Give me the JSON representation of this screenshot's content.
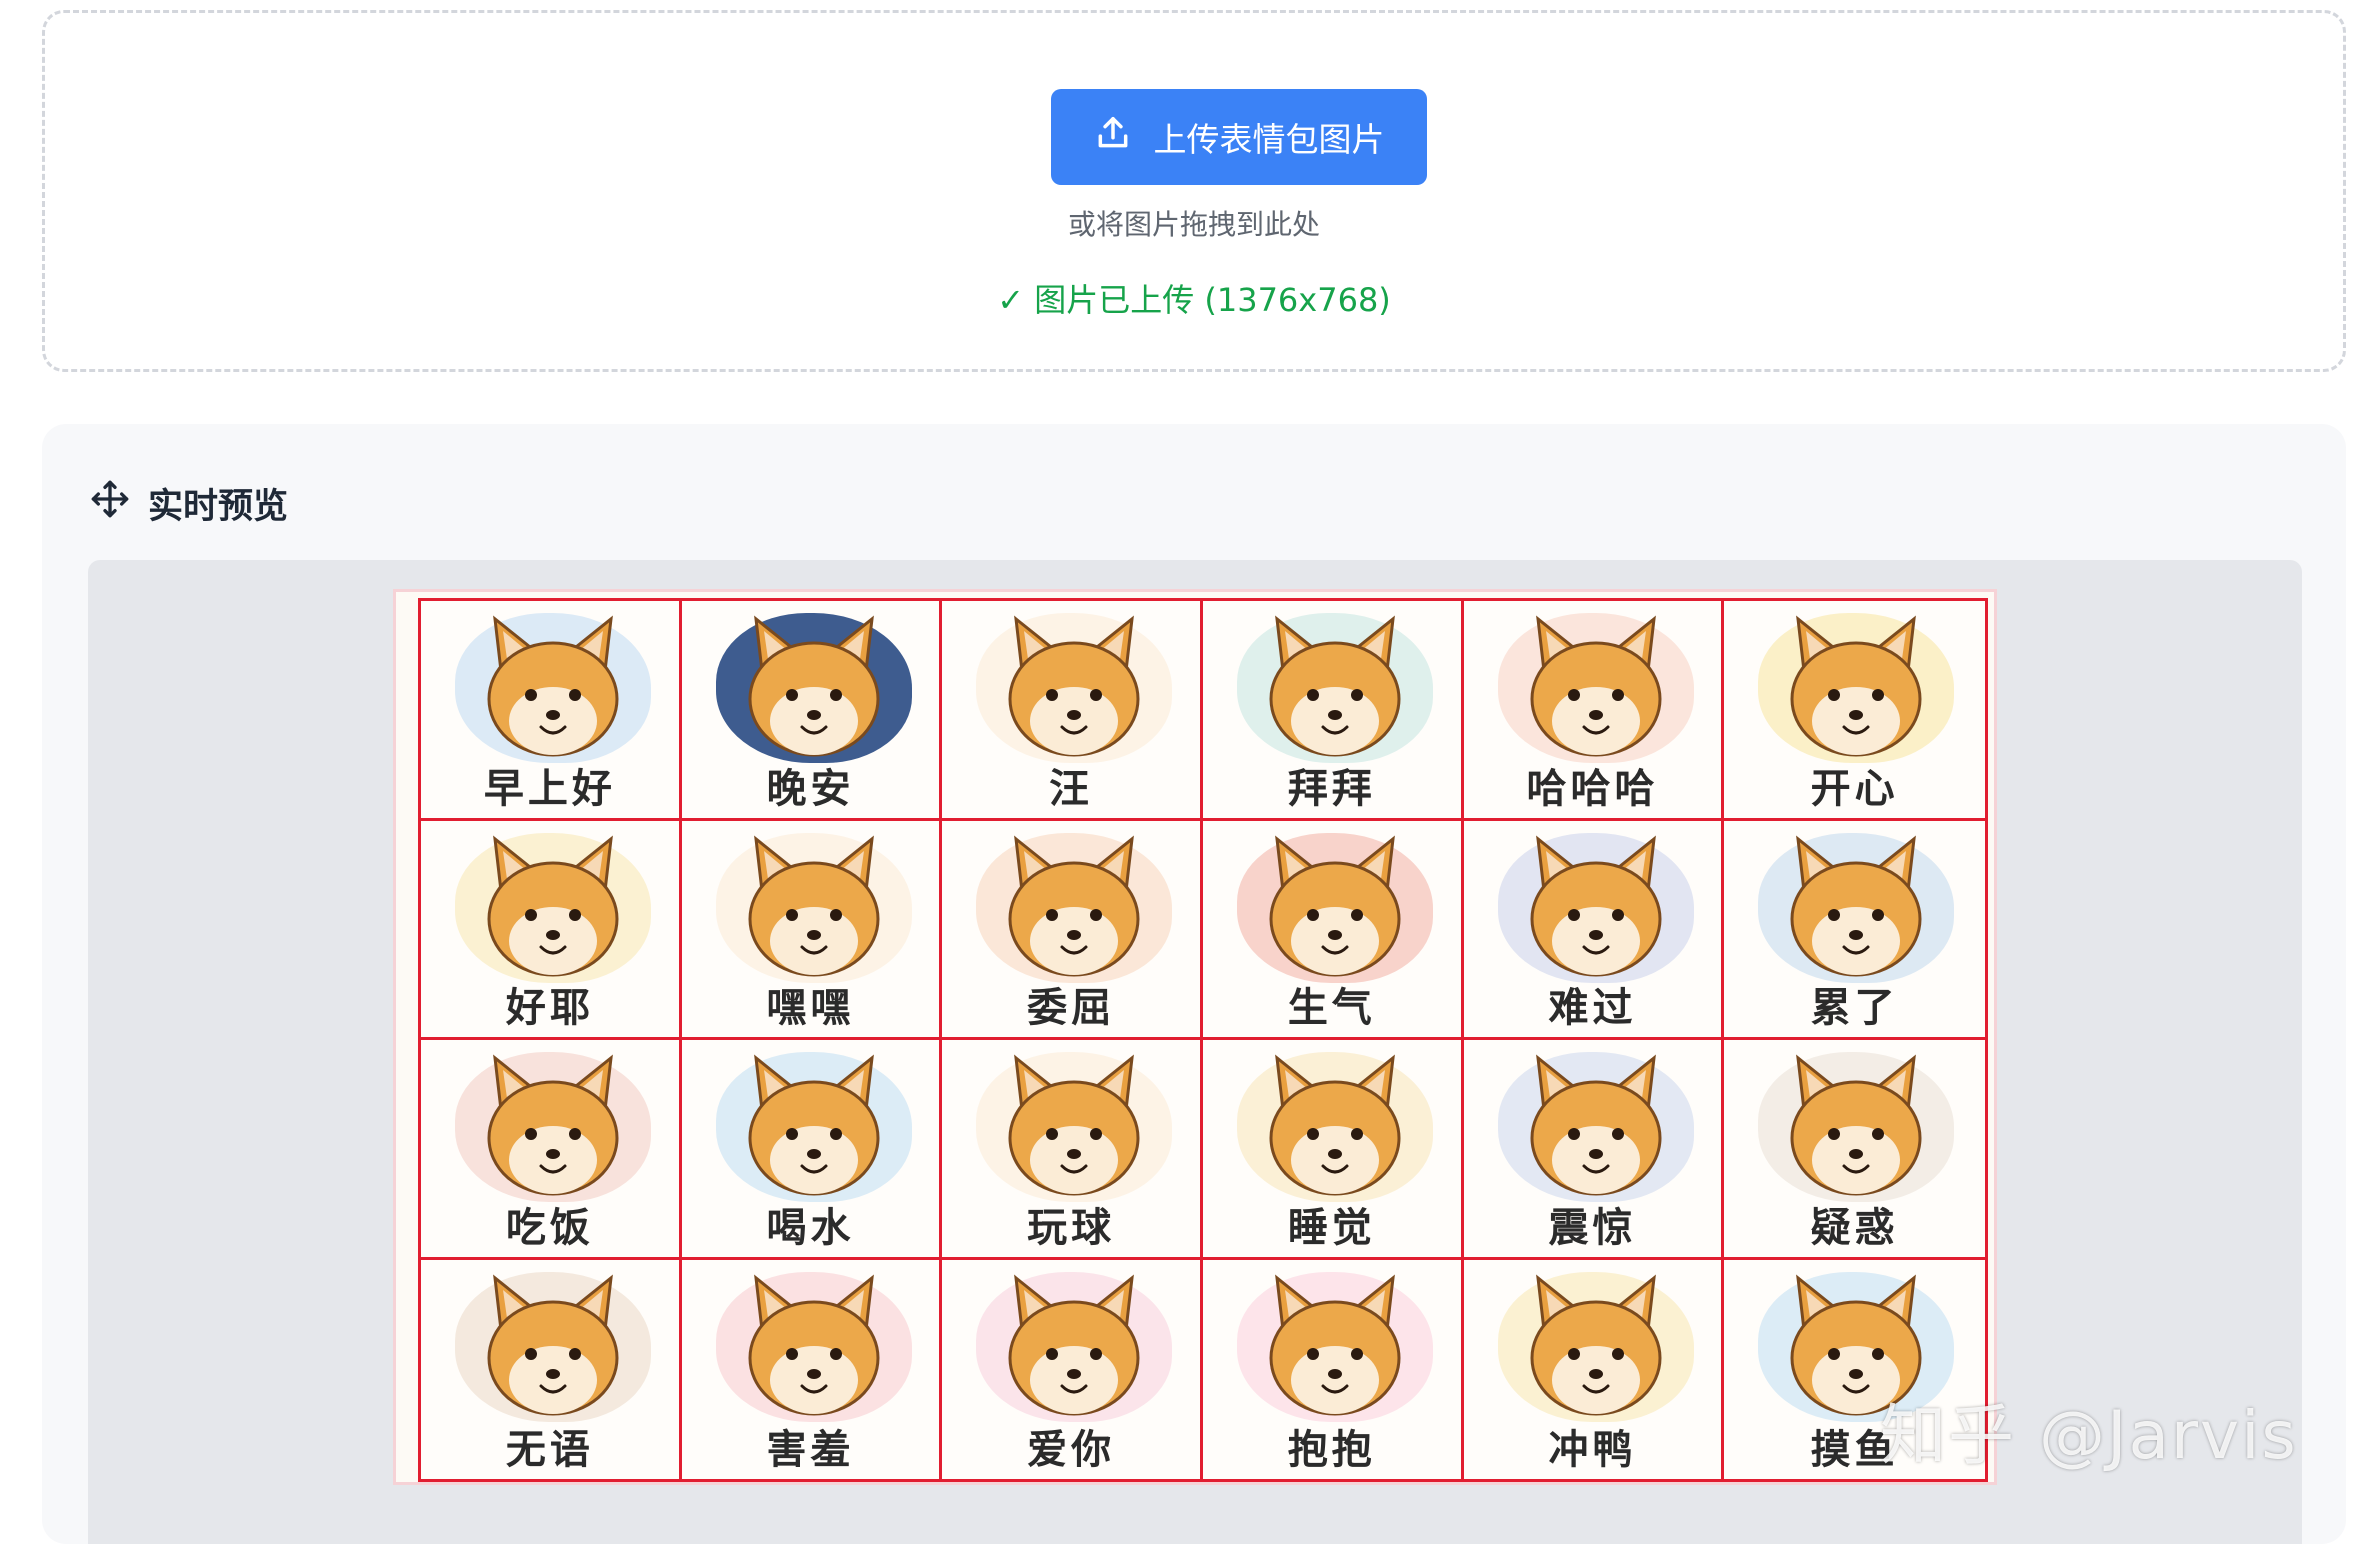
{
  "upload": {
    "button_label": "上传表情包图片",
    "drag_hint": "或将图片拖拽到此处",
    "status": "✓ 图片已上传 (1376x768)"
  },
  "preview": {
    "title": "实时预览",
    "stickers": [
      {
        "label": "早上好",
        "bg": "#dceaf6"
      },
      {
        "label": "晚安",
        "bg": "#3e5c8f"
      },
      {
        "label": "汪",
        "bg": "#fdf3e6"
      },
      {
        "label": "拜拜",
        "bg": "#dff0ec"
      },
      {
        "label": "哈哈哈",
        "bg": "#fbe5dc"
      },
      {
        "label": "开心",
        "bg": "#fbf0c8"
      },
      {
        "label": "好耶",
        "bg": "#fbf1d2"
      },
      {
        "label": "嘿嘿",
        "bg": "#fdf3e6"
      },
      {
        "label": "委屈",
        "bg": "#fbe7d8"
      },
      {
        "label": "生气",
        "bg": "#f8d3cb"
      },
      {
        "label": "难过",
        "bg": "#e2e5f2"
      },
      {
        "label": "累了",
        "bg": "#dde9f3"
      },
      {
        "label": "吃饭",
        "bg": "#f8e2dc"
      },
      {
        "label": "喝水",
        "bg": "#dcecf6"
      },
      {
        "label": "玩球",
        "bg": "#fdf3e6"
      },
      {
        "label": "睡觉",
        "bg": "#fbf0d6"
      },
      {
        "label": "震惊",
        "bg": "#e3e8f3"
      },
      {
        "label": "疑惑",
        "bg": "#f3ede6"
      },
      {
        "label": "无语",
        "bg": "#f4e9de"
      },
      {
        "label": "害羞",
        "bg": "#fbe1e2"
      },
      {
        "label": "爱你",
        "bg": "#fbe4ea"
      },
      {
        "label": "抱抱",
        "bg": "#fde4ea"
      },
      {
        "label": "冲鸭",
        "bg": "#fbf1d2"
      },
      {
        "label": "摸鱼",
        "bg": "#dcecf6"
      }
    ]
  },
  "watermark": "知乎 @Jarvis"
}
